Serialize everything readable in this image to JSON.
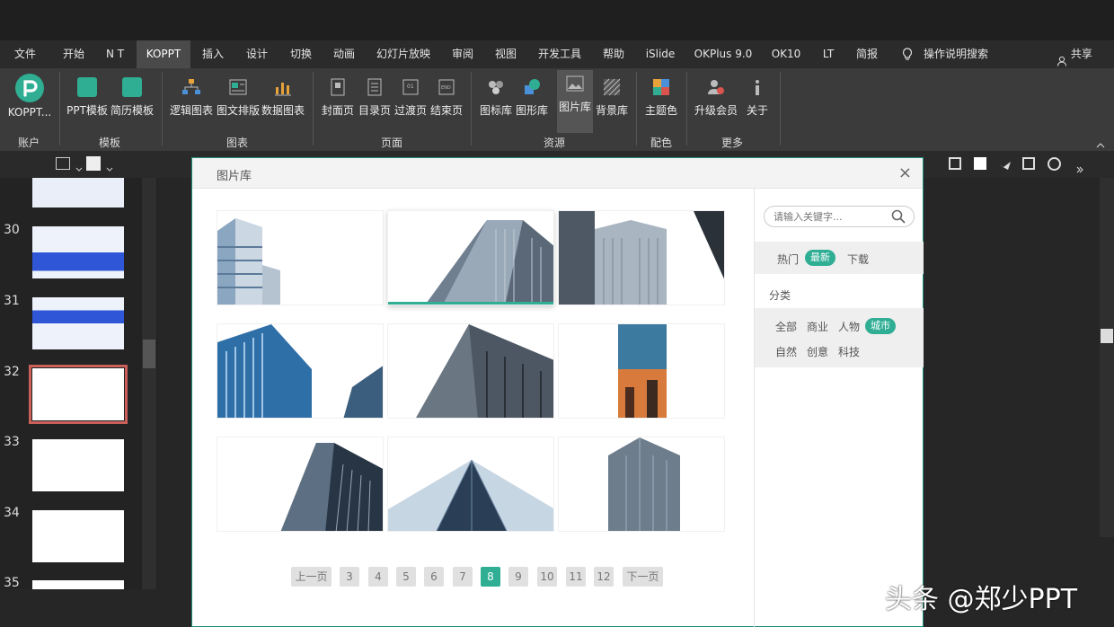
{
  "menu": {
    "tabs": [
      "文件",
      "开始",
      "N T",
      "KOPPT",
      "插入",
      "设计",
      "切换",
      "动画",
      "幻灯片放映",
      "审阅",
      "视图",
      "开发工具",
      "帮助",
      "iSlide",
      "OKPlus 9.0",
      "OK10",
      "LT",
      "简报"
    ],
    "active_tab": "KOPPT",
    "tell_me": "操作说明搜索",
    "share": "共享"
  },
  "ribbon": {
    "account": {
      "label": "KOPPT...",
      "group": "账户"
    },
    "templates": {
      "items": [
        "PPT模板",
        "简历模板"
      ],
      "group": "模板"
    },
    "charts": {
      "items": [
        "逻辑图表",
        "图文排版",
        "数据图表"
      ],
      "group": "图表"
    },
    "pages": {
      "items": [
        "封面页",
        "目录页",
        "过渡页",
        "结束页"
      ],
      "group": "页面"
    },
    "resources": {
      "items": [
        "图标库",
        "图形库",
        "图片库",
        "背景库"
      ],
      "group": "资源"
    },
    "colors": {
      "items": [
        "主题色"
      ],
      "group": "配色"
    },
    "more": {
      "items": [
        "升级会员",
        "关于"
      ],
      "group": "更多"
    },
    "colors_map": {
      "accent": "#2fae94",
      "icon_blue": "#4a90d9",
      "icon_green": "#2fae94"
    }
  },
  "slides": {
    "numbers": [
      "30",
      "31",
      "32",
      "33",
      "34",
      "35"
    ],
    "selected": "32"
  },
  "dialog": {
    "title": "图片库",
    "close": "×",
    "search_placeholder": "请输入关键字...",
    "tabs": [
      "热门",
      "最新",
      "下载"
    ],
    "active_tab": "最新",
    "category_label": "分类",
    "categories": [
      "全部",
      "商业",
      "人物",
      "城市",
      "自然",
      "创意",
      "科技"
    ],
    "active_category": "城市",
    "pagination": {
      "prev": "上一页",
      "pages": [
        "3",
        "4",
        "5",
        "6",
        "7",
        "8",
        "9",
        "10",
        "11",
        "12"
      ],
      "current": "8",
      "next": "下一页"
    }
  },
  "watermark": "头条 @郑少PPT"
}
